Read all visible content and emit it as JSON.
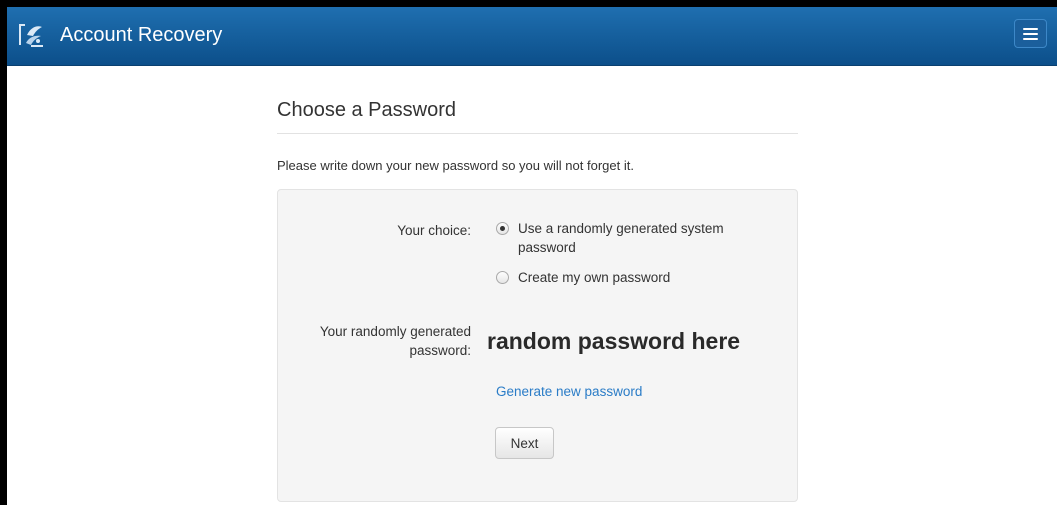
{
  "header": {
    "app_title": "Account Recovery",
    "logo_icon": "brand-logo-icon",
    "menu_icon": "hamburger-menu-icon",
    "background": "#1565a6"
  },
  "page": {
    "title": "Choose a Password",
    "intro": "Please write down your new password so you will not forget it."
  },
  "form": {
    "choice_label": "Your choice:",
    "options": [
      {
        "label": "Use a randomly generated system password",
        "selected": true
      },
      {
        "label": "Create my own password",
        "selected": false
      }
    ],
    "generated_label": "Your randomly generated password:",
    "generated_password": "random password here",
    "generate_link": "Generate new password",
    "link_color": "#2a7cc7",
    "next_button": "Next"
  }
}
